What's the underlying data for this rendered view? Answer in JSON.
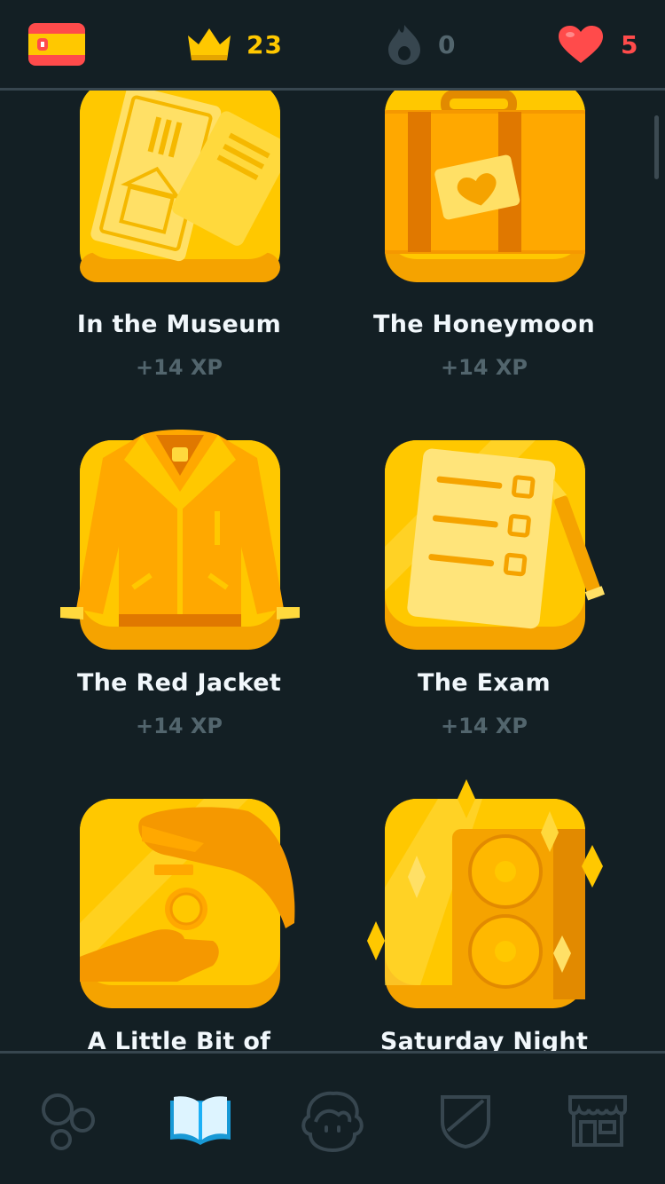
{
  "topbar": {
    "language_flag": "spain-flag-icon",
    "crowns": "23",
    "streak": "0",
    "hearts": "5"
  },
  "stories": [
    {
      "title": "In the Museum",
      "xp": "+14 XP",
      "icon": "museum-tickets-icon"
    },
    {
      "title": "The Honeymoon",
      "xp": "+14 XP",
      "icon": "suitcase-icon"
    },
    {
      "title": "The Red Jacket",
      "xp": "+14 XP",
      "icon": "jacket-icon"
    },
    {
      "title": "The Exam",
      "xp": "+14 XP",
      "icon": "exam-paper-icon"
    },
    {
      "title": "A Little Bit of Money",
      "icon": "money-hands-icon"
    },
    {
      "title": "Saturday Night",
      "icon": "speaker-icon"
    }
  ],
  "bottom_nav": [
    {
      "name": "learn-tab",
      "icon": "bubbles-icon",
      "active": false
    },
    {
      "name": "stories-tab",
      "icon": "book-icon",
      "active": true
    },
    {
      "name": "profile-tab",
      "icon": "avatar-icon",
      "active": false
    },
    {
      "name": "leagues-tab",
      "icon": "shield-icon",
      "active": false
    },
    {
      "name": "shop-tab",
      "icon": "shop-icon",
      "active": false
    }
  ],
  "colors": {
    "background": "#131F24",
    "gold": "#FFC800",
    "heart": "#FF4B4B",
    "muted": "#52656D",
    "active_tab": "#1CB0F6"
  }
}
